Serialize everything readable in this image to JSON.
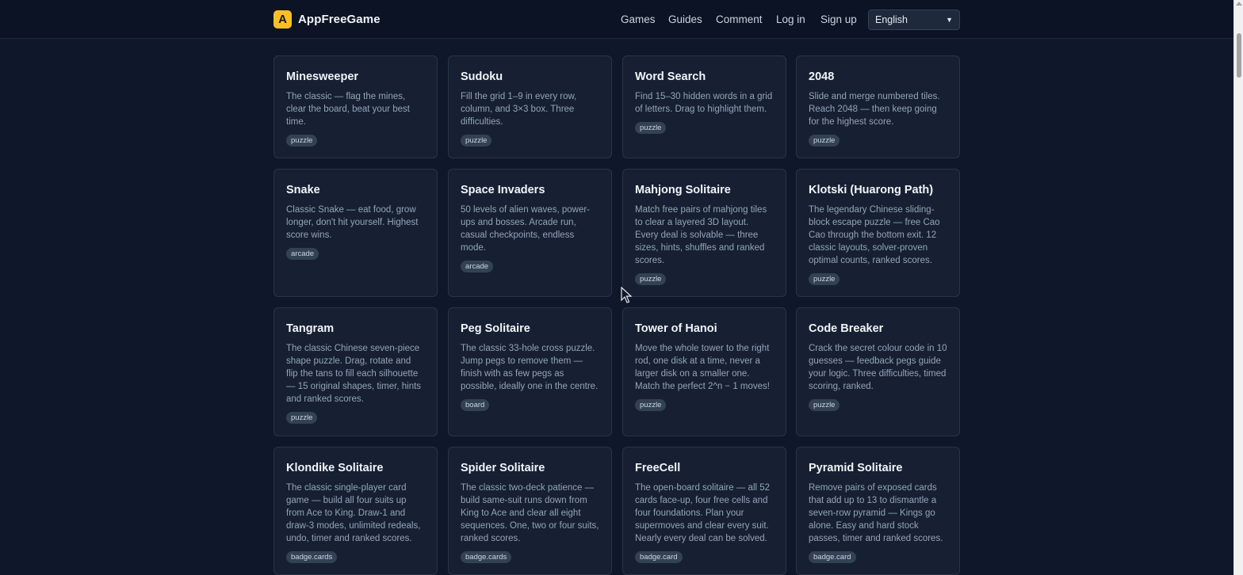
{
  "header": {
    "logo_letter": "A",
    "brand": "AppFreeGame",
    "nav": [
      "Games",
      "Guides",
      "Comment",
      "Log in",
      "Sign up"
    ],
    "language": "English"
  },
  "games": [
    {
      "title": "Minesweeper",
      "desc": "The classic — flag the mines, clear the board, beat your best time.",
      "badge": "puzzle"
    },
    {
      "title": "Sudoku",
      "desc": "Fill the grid 1–9 in every row, column, and 3×3 box. Three difficulties.",
      "badge": "puzzle"
    },
    {
      "title": "Word Search",
      "desc": "Find 15–30 hidden words in a grid of letters. Drag to highlight them.",
      "badge": "puzzle"
    },
    {
      "title": "2048",
      "desc": "Slide and merge numbered tiles. Reach 2048 — then keep going for the highest score.",
      "badge": "puzzle"
    },
    {
      "title": "Snake",
      "desc": "Classic Snake — eat food, grow longer, don't hit yourself. Highest score wins.",
      "badge": "arcade"
    },
    {
      "title": "Space Invaders",
      "desc": "50 levels of alien waves, power-ups and bosses. Arcade run, casual checkpoints, endless mode.",
      "badge": "arcade"
    },
    {
      "title": "Mahjong Solitaire",
      "desc": "Match free pairs of mahjong tiles to clear a layered 3D layout. Every deal is solvable — three sizes, hints, shuffles and ranked scores.",
      "badge": "puzzle"
    },
    {
      "title": "Klotski (Huarong Path)",
      "desc": "The legendary Chinese sliding-block escape puzzle — free Cao Cao through the bottom exit. 12 classic layouts, solver-proven optimal counts, ranked scores.",
      "badge": "puzzle"
    },
    {
      "title": "Tangram",
      "desc": "The classic Chinese seven-piece shape puzzle. Drag, rotate and flip the tans to fill each silhouette — 15 original shapes, timer, hints and ranked scores.",
      "badge": "puzzle"
    },
    {
      "title": "Peg Solitaire",
      "desc": "The classic 33-hole cross puzzle. Jump pegs to remove them — finish with as few pegs as possible, ideally one in the centre.",
      "badge": "board"
    },
    {
      "title": "Tower of Hanoi",
      "desc": "Move the whole tower to the right rod, one disk at a time, never a larger disk on a smaller one. Match the perfect 2^n − 1 moves!",
      "badge": "puzzle"
    },
    {
      "title": "Code Breaker",
      "desc": "Crack the secret colour code in 10 guesses — feedback pegs guide your logic. Three difficulties, timed scoring, ranked.",
      "badge": "puzzle"
    },
    {
      "title": "Klondike Solitaire",
      "desc": "The classic single-player card game — build all four suits up from Ace to King. Draw-1 and draw-3 modes, unlimited redeals, undo, timer and ranked scores.",
      "badge": "badge.cards"
    },
    {
      "title": "Spider Solitaire",
      "desc": "The classic two-deck patience — build same-suit runs down from King to Ace and clear all eight sequences. One, two or four suits, ranked scores.",
      "badge": "badge.cards"
    },
    {
      "title": "FreeCell",
      "desc": "The open-board solitaire — all 52 cards face-up, four free cells and four foundations. Plan your supermoves and clear every suit. Nearly every deal can be solved.",
      "badge": "badge.card"
    },
    {
      "title": "Pyramid Solitaire",
      "desc": "Remove pairs of exposed cards that add up to 13 to dismantle a seven-row pyramid — Kings go alone. Easy and hard stock passes, timer and ranked scores.",
      "badge": "badge.card"
    }
  ]
}
